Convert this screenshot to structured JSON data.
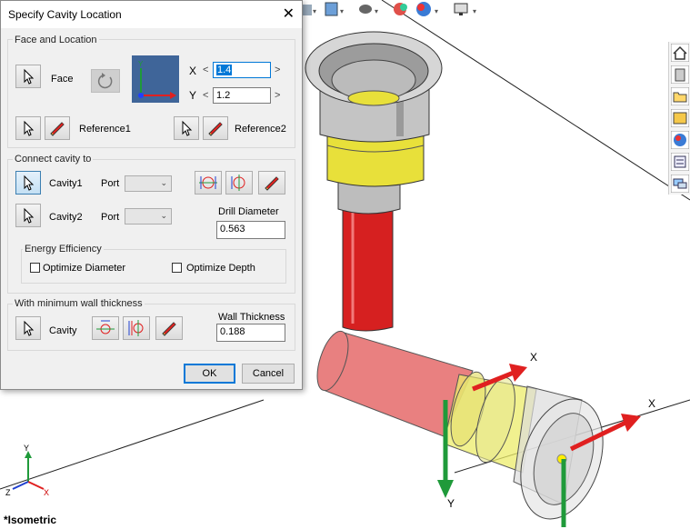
{
  "dialog": {
    "title": "Specify Cavity Location",
    "face_location": {
      "group_label": "Face and Location",
      "face_label": "Face",
      "x_label": "X",
      "x_value": "1.4",
      "y_label": "Y",
      "y_value": "1.2",
      "nav_left": "<",
      "nav_right": ">",
      "reference1_label": "Reference1",
      "reference2_label": "Reference2"
    },
    "connect": {
      "group_label": "Connect cavity to",
      "cavity1_label": "Cavity1",
      "cavity2_label": "Cavity2",
      "port_label": "Port",
      "drill_diameter_label": "Drill Diameter",
      "drill_diameter_value": "0.563",
      "energy_label": "Energy Efficiency",
      "optimize_diameter_label": "Optimize Diameter",
      "optimize_depth_label": "Optimize Depth"
    },
    "wall": {
      "group_label": "With minimum wall thickness",
      "cavity_label": "Cavity",
      "wall_thickness_label": "Wall Thickness",
      "wall_thickness_value": "0.188"
    },
    "ok_label": "OK",
    "cancel_label": "Cancel"
  },
  "viewport": {
    "view_name": "*Isometric",
    "axis_x": "X",
    "axis_y": "Y",
    "triad_x": "X",
    "triad_y": "Y",
    "triad_z": "Z"
  },
  "toolbar_icons": [
    "section-view-icon",
    "view-orientation-icon",
    "hide-show-icon",
    "appearance-icon",
    "scene-icon",
    "display-monitor-icon"
  ],
  "sidebar_icons": [
    "home-icon",
    "parts-library-icon",
    "folder-icon",
    "view-palette-icon",
    "appearances-icon",
    "custom-properties-icon",
    "forum-icon"
  ],
  "colors": {
    "red_body": "#d62020",
    "yellow_body": "#e8e03a",
    "gray_body": "#bdbdbd",
    "arrow_green": "#1f9a3a",
    "arrow_red": "#e02020"
  }
}
